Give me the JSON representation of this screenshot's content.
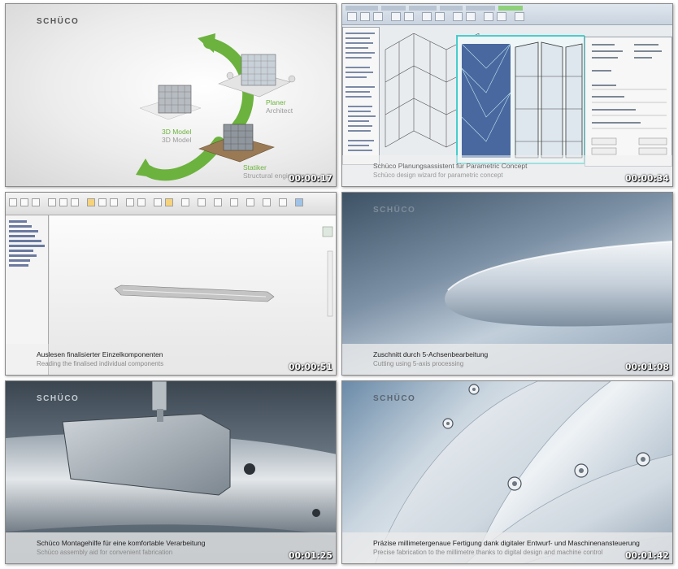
{
  "thumbnails": [
    {
      "logo": "SCHÜCO",
      "timestamp": "00:00:17",
      "labels": [
        {
          "primary": "Planer",
          "secondary": "Architect"
        },
        {
          "primary": "3D Model",
          "secondary": "3D Model"
        },
        {
          "primary": "Statiker",
          "secondary": "Structural engineers"
        }
      ]
    },
    {
      "timestamp": "00:00:34",
      "caption_primary": "Schüco Planungsassistent für Parametric Concept",
      "caption_secondary": "Schüco design wizard for parametric concept"
    },
    {
      "timestamp": "00:00:51",
      "caption_primary": "Auslesen finalisierter Einzelkomponenten",
      "caption_secondary": "Reading the finalised individual components"
    },
    {
      "logo": "SCHÜCO",
      "timestamp": "00:01:08",
      "caption_primary": "Zuschnitt durch 5-Achsenbearbeitung",
      "caption_secondary": "Cutting using 5-axis processing"
    },
    {
      "logo": "SCHÜCO",
      "timestamp": "00:01:25",
      "caption_primary": "Schüco Montagehilfe für eine komfortable Verarbeitung",
      "caption_secondary": "Schüco assembly aid for convenient fabrication"
    },
    {
      "logo": "SCHÜCO",
      "timestamp": "00:01:42",
      "caption_primary": "Präzise millimetergenaue Fertigung dank digitaler Entwurf- und Maschinenansteuerung",
      "caption_secondary": "Precise fabrication to the millimetre thanks to digital design and machine control"
    }
  ],
  "colors": {
    "green": "#6cb23e",
    "timestamp": "#ffffff",
    "caption_bar": "#ebebeb"
  }
}
